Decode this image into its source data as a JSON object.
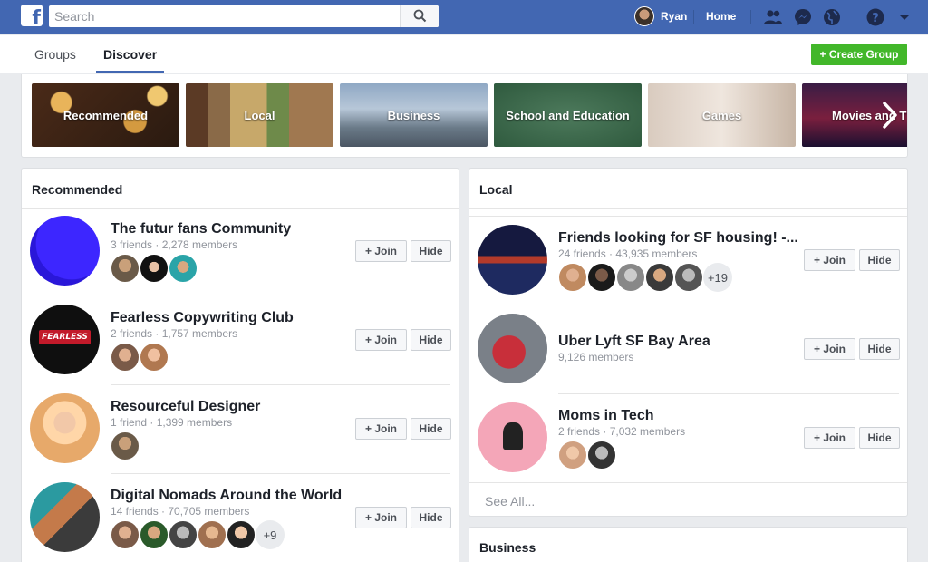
{
  "topbar": {
    "search_placeholder": "Search",
    "profile_name": "Ryan",
    "home_label": "Home",
    "brand_color": "#4267b2"
  },
  "tabs": [
    {
      "label": "Groups",
      "active": false
    },
    {
      "label": "Discover",
      "active": true
    }
  ],
  "create_group_label": "+ Create Group",
  "categories": [
    "Recommended",
    "Local",
    "Business",
    "School and Education",
    "Games",
    "Movies and T"
  ],
  "recommended": {
    "title": "Recommended",
    "groups": [
      {
        "name": "The futur fans Community",
        "meta": "3 friends · 2,278 members",
        "friend_count": 3
      },
      {
        "name": "Fearless Copywriting Club",
        "meta": "2 friends · 1,757 members",
        "friend_count": 2,
        "thumb_text": "FEARLESS"
      },
      {
        "name": "Resourceful Designer",
        "meta": "1 friend · 1,399 members",
        "friend_count": 1
      },
      {
        "name": "Digital Nomads Around the World",
        "meta": "14 friends · 70,705 members",
        "friend_count": 5,
        "more": "+9"
      }
    ]
  },
  "local": {
    "title": "Local",
    "groups": [
      {
        "name": "Friends looking for SF housing! -...",
        "meta": "24 friends · 43,935 members",
        "friend_count": 5,
        "more": "+19"
      },
      {
        "name": "Uber Lyft SF Bay Area",
        "meta": "9,126 members",
        "friend_count": 0
      },
      {
        "name": "Moms in Tech",
        "meta": "2 friends · 7,032 members",
        "friend_count": 2
      }
    ],
    "see_all": "See All..."
  },
  "business": {
    "title": "Business"
  },
  "buttons": {
    "join": "+ Join",
    "hide": "Hide"
  }
}
